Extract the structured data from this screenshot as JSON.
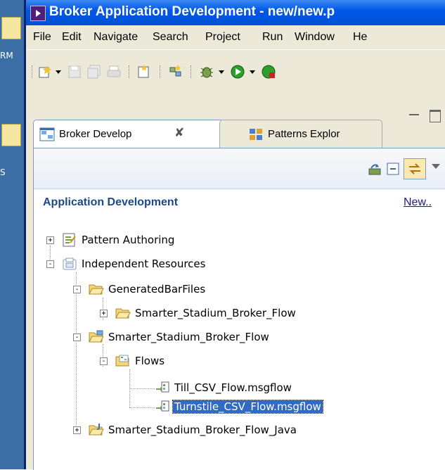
{
  "window": {
    "title": "Broker Application Development - new/new.p"
  },
  "desktop": {
    "labels": [
      "RM",
      "S"
    ]
  },
  "menu": [
    "File",
    "Edit",
    "Navigate",
    "Search",
    "Project",
    "Run",
    "Window",
    "He"
  ],
  "tabs": [
    {
      "label": "Broker Develop",
      "active": true,
      "close": "✘"
    },
    {
      "label": "Patterns Explor",
      "active": false
    }
  ],
  "panel": {
    "section_title": "Application Development",
    "new_link": "New.."
  },
  "tree": [
    {
      "label": "Pattern Authoring",
      "depth": 0,
      "expander": "+",
      "icon": "pattern-authoring-icon"
    },
    {
      "label": "Independent Resources",
      "depth": 0,
      "expander": "-",
      "icon": "folder-resources-icon"
    },
    {
      "label": "GeneratedBarFiles",
      "depth": 1,
      "expander": "-",
      "icon": "folder-open-icon"
    },
    {
      "label": "Smarter_Stadium_Broker_Flow",
      "depth": 2,
      "expander": "+",
      "icon": "folder-icon"
    },
    {
      "label": "Smarter_Stadium_Broker_Flow",
      "depth": 1,
      "expander": "-",
      "icon": "project-folder-icon"
    },
    {
      "label": "Flows",
      "depth": 2,
      "expander": "-",
      "icon": "flows-folder-icon"
    },
    {
      "label": "Till_CSV_Flow.msgflow",
      "depth": 3,
      "expander": "",
      "icon": "msgflow-icon"
    },
    {
      "label": "Turnstile_CSV_Flow.msgflow",
      "depth": 3,
      "expander": "",
      "icon": "msgflow-icon",
      "selected": true
    },
    {
      "label": "Smarter_Stadium_Broker_Flow_Java",
      "depth": 1,
      "expander": "+",
      "icon": "java-project-icon"
    }
  ],
  "colors": {
    "selection": "#316ac5",
    "titlebar": "#0058e6",
    "section_title": "#1a4a8a"
  }
}
